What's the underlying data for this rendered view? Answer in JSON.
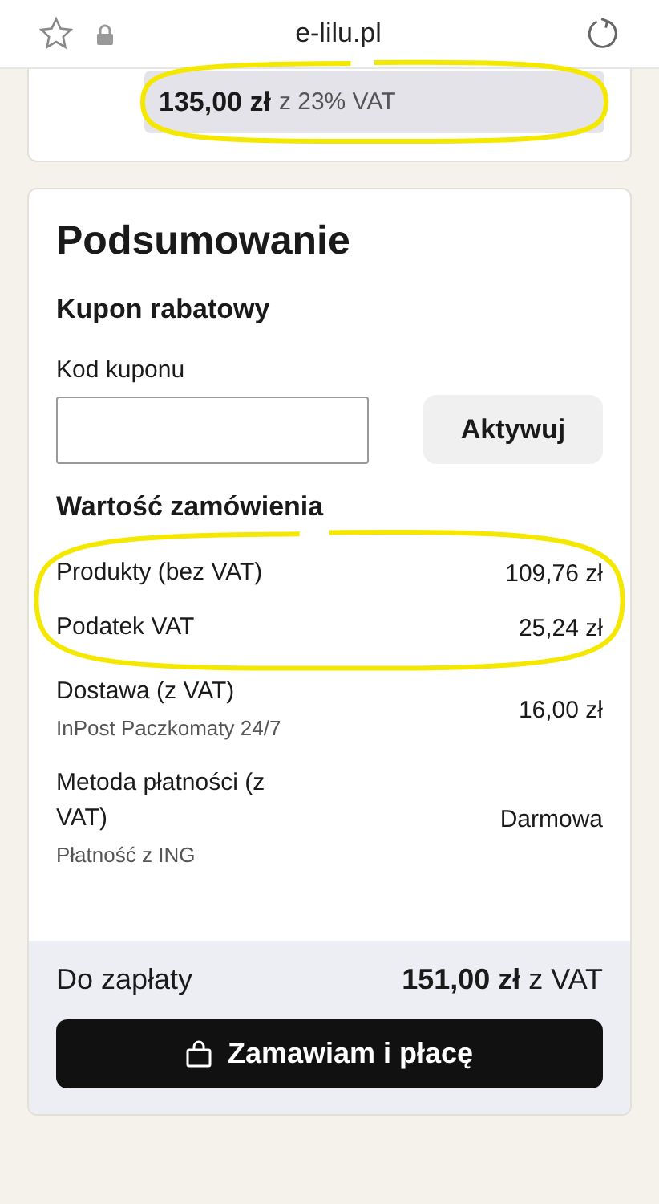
{
  "browser": {
    "url": "e-lilu.pl"
  },
  "price": {
    "amount": "135,00 zł",
    "note": "z 23% VAT",
    "highlighted": true
  },
  "summary": {
    "title": "Podsumowanie",
    "coupon": {
      "heading": "Kupon rabatowy",
      "label": "Kod kuponu",
      "button": "Aktywuj"
    },
    "order_value": {
      "heading": "Wartość zamówienia",
      "groups": [
        {
          "highlighted": true,
          "rows": [
            {
              "label": "Produkty (bez VAT)",
              "value": "109,76 zł"
            },
            {
              "label": "Podatek VAT",
              "value": "25,24 zł"
            }
          ]
        },
        {
          "highlighted": false,
          "rows": [
            {
              "label": "Dostawa (z VAT)",
              "detail": "InPost Paczkomaty 24/7",
              "value": "16,00 zł"
            },
            {
              "label": "Metoda płatności (z VAT)",
              "detail": "Płatność z ING",
              "value": "Darmowa"
            }
          ]
        }
      ]
    },
    "total": {
      "label": "Do zapłaty",
      "amount": "151,00 zł",
      "note": "z VAT"
    },
    "order_button": "Zamawiam i płacę"
  }
}
